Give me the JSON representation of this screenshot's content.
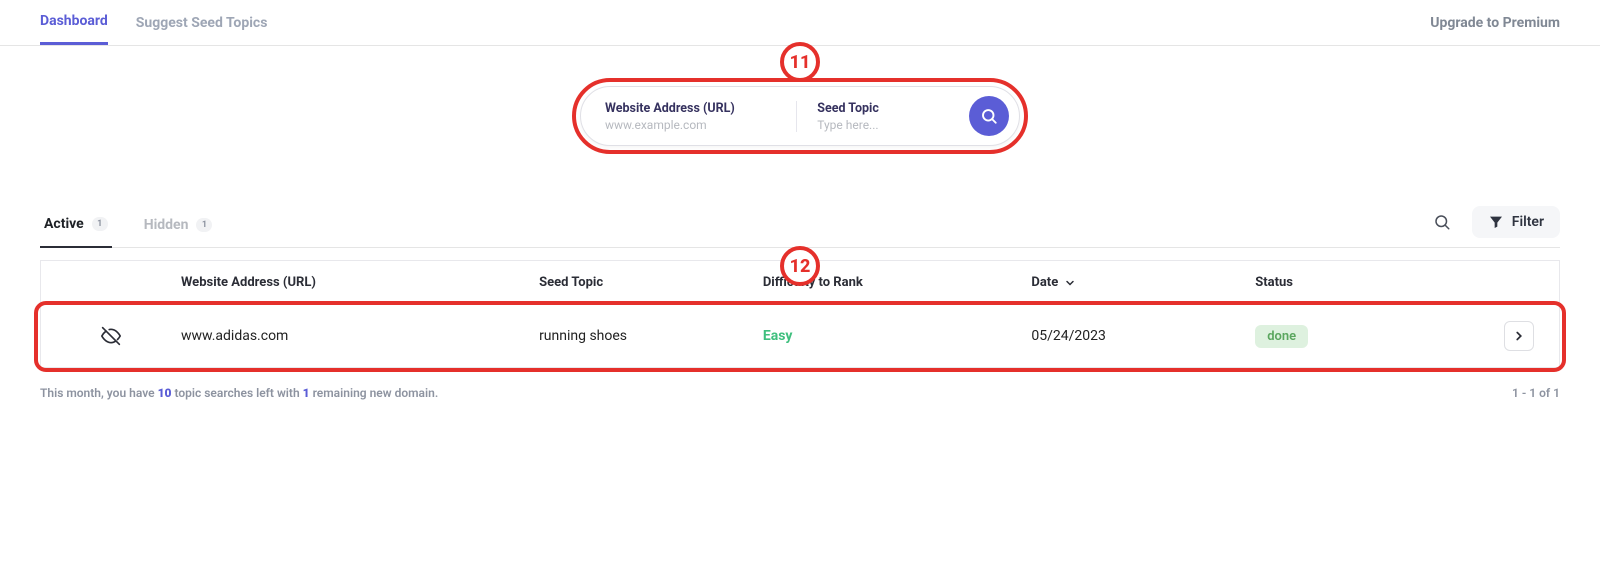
{
  "nav": {
    "dashboard": "Dashboard",
    "suggest": "Suggest Seed Topics",
    "premium": "Upgrade to Premium"
  },
  "annotations": {
    "search": "11",
    "row": "12"
  },
  "search": {
    "url_label": "Website Address (URL)",
    "url_placeholder": "www.example.com",
    "seed_label": "Seed Topic",
    "seed_placeholder": "Type here..."
  },
  "tabs": {
    "active_label": "Active",
    "active_count": "1",
    "hidden_label": "Hidden",
    "hidden_count": "1"
  },
  "actions": {
    "filter": "Filter"
  },
  "columns": {
    "url": "Website Address (URL)",
    "seed": "Seed Topic",
    "difficulty": "Difficulty to Rank",
    "date": "Date",
    "status": "Status"
  },
  "rows": [
    {
      "url": "www.adidas.com",
      "seed": "running shoes",
      "difficulty": "Easy",
      "date": "05/24/2023",
      "status": "done"
    }
  ],
  "footer": {
    "pre1": "This month, you have ",
    "searches": "10",
    "mid1": " topic searches left with ",
    "domains": "1",
    "post1": " remaining new domain.",
    "pagination": "1 - 1 of 1"
  }
}
